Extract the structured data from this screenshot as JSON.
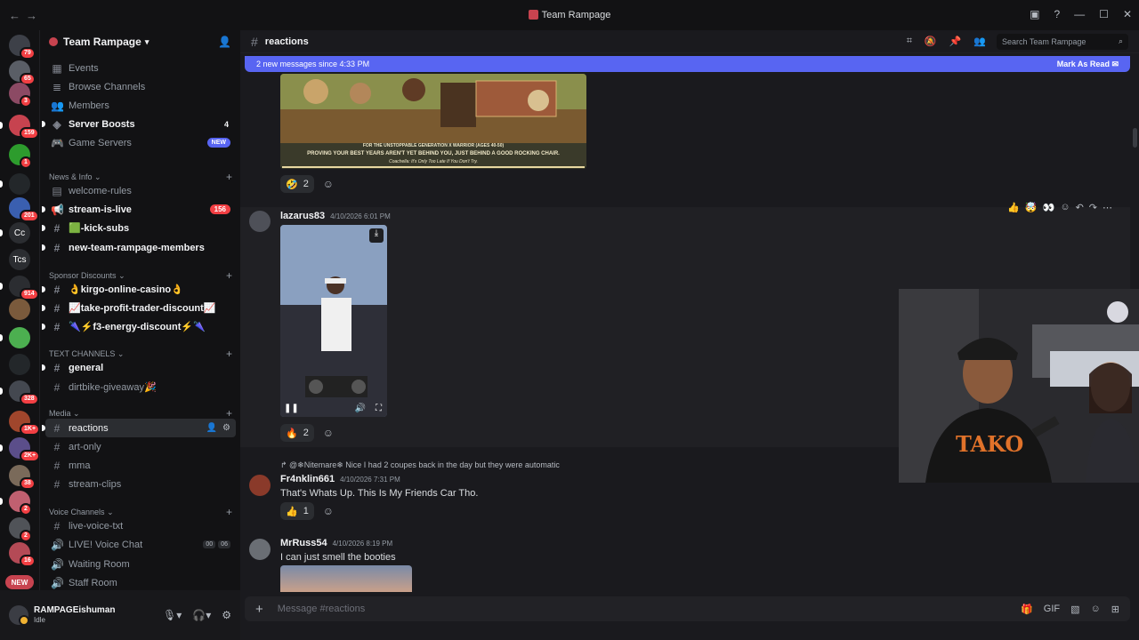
{
  "window": {
    "title": "Team Rampage"
  },
  "rail": {
    "servers": [
      {
        "badge": "79",
        "color": "#3d4048",
        "label": ""
      },
      {
        "badge": "65",
        "color": "#5a5e66",
        "label": ""
      },
      {
        "badge": "3",
        "color": "#8c4a64",
        "label": ""
      },
      {
        "badge": "159",
        "color": "#c7434f",
        "label": ""
      },
      {
        "badge": "1",
        "color": "#2d9c2d",
        "label": ""
      },
      {
        "badge": "",
        "color": "#23272a",
        "label": ""
      },
      {
        "badge": "201",
        "color": "#3a5fb0",
        "label": ""
      },
      {
        "badge": "",
        "color": "#2b2d31",
        "label": "Cc"
      },
      {
        "badge": "",
        "color": "#2b2d31",
        "label": "Tcs"
      },
      {
        "badge": "914",
        "color": "#2b2d31",
        "label": ""
      },
      {
        "badge": "",
        "color": "#7a5a3c",
        "label": ""
      },
      {
        "badge": "",
        "color": "#4caf50",
        "label": ""
      },
      {
        "badge": "",
        "color": "#23272a",
        "label": ""
      },
      {
        "badge": "328",
        "color": "#444850",
        "label": ""
      },
      {
        "badge": "1K+",
        "color": "#a0462c",
        "label": ""
      },
      {
        "badge": "2K+",
        "color": "#5b4e8a",
        "label": ""
      },
      {
        "badge": "38",
        "color": "#7a6a5a",
        "label": ""
      },
      {
        "badge": "2",
        "color": "#c06070",
        "label": ""
      },
      {
        "badge": "2",
        "color": "#505358",
        "label": ""
      },
      {
        "badge": "16",
        "color": "#b44a56",
        "label": ""
      }
    ],
    "new_label": "NEW"
  },
  "sidebar": {
    "server_name": "Team Rampage",
    "top_items": [
      {
        "label": "Events",
        "icon": "calendar-icon"
      },
      {
        "label": "Browse Channels",
        "icon": "browse-icon"
      },
      {
        "label": "Members",
        "icon": "members-icon"
      },
      {
        "label": "Server Boosts",
        "icon": "boost-icon",
        "count": "4"
      },
      {
        "label": "Game Servers",
        "icon": "controller-icon",
        "new": "NEW"
      }
    ],
    "categories": [
      {
        "name": "News & Info"
      },
      {
        "name": "Sponsor Discounts"
      },
      {
        "name": "TEXT CHANNELS"
      },
      {
        "name": "Media"
      },
      {
        "name": "Voice Channels"
      }
    ],
    "channels": {
      "welcome_rules": "welcome-rules",
      "stream_is_live": "stream-is-live",
      "stream_is_live_count": "156",
      "kick_subs": "🟩-kick-subs",
      "new_members": "new-team-rampage-members",
      "kirgo": "👌kirgo-online-casino👌",
      "take_profit": "📈take-profit-trader-discount📈",
      "f3": "🌂⚡f3-energy-discount⚡🌂",
      "general": "general",
      "dirtbike": "dirtbike-giveaway🎉",
      "reactions": "reactions",
      "art_only": "art-only",
      "mma": "mma",
      "stream_clips": "stream-clips",
      "live_voice_txt": "live-voice-txt",
      "live_voice_chat": "LIVE! Voice Chat",
      "voice_counts": [
        "00",
        "06"
      ],
      "waiting_room": "Waiting Room",
      "staff_room": "Staff Room"
    }
  },
  "user": {
    "name": "RAMPAGEishuman",
    "status": "Idle"
  },
  "channel_header": {
    "name": "reactions",
    "search_placeholder": "Search Team Rampage"
  },
  "new_messages_bar": {
    "text": "2 new messages since 4:33 PM",
    "action": "Mark As Read"
  },
  "messages": [
    {
      "image_caption_1": "FOR THE UNSTOPPABLE GENERATION X WARRIOR (AGES 40-50)",
      "image_caption_2": "PROVING YOUR BEST YEARS AREN'T YET BEHIND YOU, JUST BEHIND A GOOD ROCKING CHAIR.",
      "image_caption_3": "Coachella: It's Only Too Late If You Don't Try.",
      "reaction_emoji": "🤣",
      "reaction_count": "2"
    },
    {
      "user": "lazarus83",
      "time": "4/10/2026 6:01 PM",
      "reaction_emoji": "🔥",
      "reaction_count": "2",
      "hover_emojis": [
        "👍",
        "🤯",
        "👀"
      ]
    },
    {
      "reply_user": "@❄Nitemare❄",
      "reply_text": "Nice I had 2 coupes back in the day but they were automatic",
      "user": "Fr4nklin661",
      "time": "4/10/2026 7:31 PM",
      "text": "That's Whats Up. This Is My Friends Car Tho.",
      "reaction_emoji": "👍",
      "reaction_count": "1"
    },
    {
      "user": "MrRuss54",
      "time": "4/10/2026 8:19 PM",
      "text": "I can just smell the booties"
    }
  ],
  "composer": {
    "placeholder": "Message #reactions"
  },
  "overlay": {
    "shirt_text": "TAKO"
  }
}
